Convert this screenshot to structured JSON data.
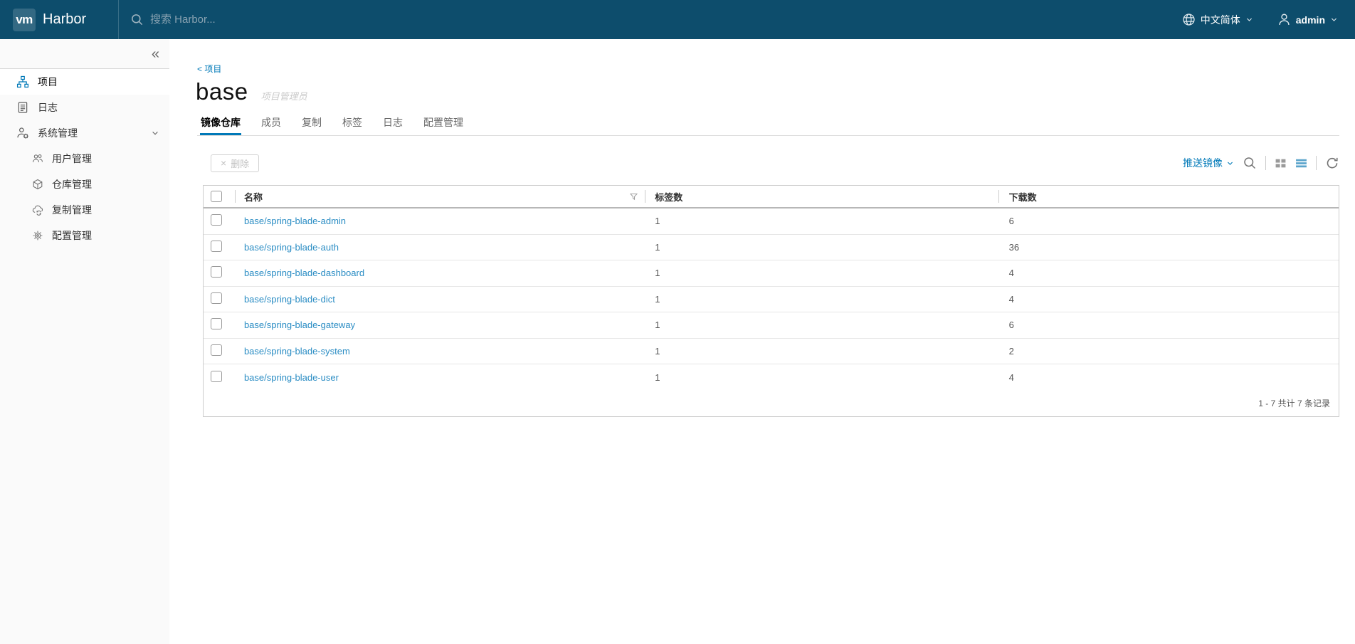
{
  "colors": {
    "header_bg": "#0d4d6c",
    "accent_blue": "#0079b8",
    "link_blue": "#2b8dc4",
    "sidebar_bg": "#fafafa"
  },
  "header": {
    "logo": "vm",
    "product_name": "Harbor",
    "search_placeholder": "搜索 Harbor...",
    "language_label": "中文简体",
    "user_name": "admin"
  },
  "sidebar": {
    "collapse_glyph": "«",
    "items": [
      {
        "label": "项目"
      },
      {
        "label": "日志"
      },
      {
        "label": "系统管理"
      }
    ],
    "subitems": [
      {
        "label": "用户管理"
      },
      {
        "label": "仓库管理"
      },
      {
        "label": "复制管理"
      },
      {
        "label": "配置管理"
      }
    ]
  },
  "main": {
    "breadcrumb": {
      "back": "<",
      "label": "项目"
    },
    "title": "base",
    "role": "项目管理员",
    "tabs": [
      {
        "label": "镜像仓库"
      },
      {
        "label": "成员"
      },
      {
        "label": "复制"
      },
      {
        "label": "标签"
      },
      {
        "label": "日志"
      },
      {
        "label": "配置管理"
      }
    ],
    "toolbar": {
      "delete_label": "删除",
      "delete_glyph": "×",
      "push_image_label": "推送镜像"
    },
    "table": {
      "headers": {
        "name": "名称",
        "tags": "标签数",
        "pulls": "下载数"
      },
      "rows": [
        {
          "name": "base/spring-blade-admin",
          "tags": "1",
          "pulls": "6"
        },
        {
          "name": "base/spring-blade-auth",
          "tags": "1",
          "pulls": "36"
        },
        {
          "name": "base/spring-blade-dashboard",
          "tags": "1",
          "pulls": "4"
        },
        {
          "name": "base/spring-blade-dict",
          "tags": "1",
          "pulls": "4"
        },
        {
          "name": "base/spring-blade-gateway",
          "tags": "1",
          "pulls": "6"
        },
        {
          "name": "base/spring-blade-system",
          "tags": "1",
          "pulls": "2"
        },
        {
          "name": "base/spring-blade-user",
          "tags": "1",
          "pulls": "4"
        }
      ],
      "footer": "1 - 7 共计 7 条记录"
    }
  }
}
